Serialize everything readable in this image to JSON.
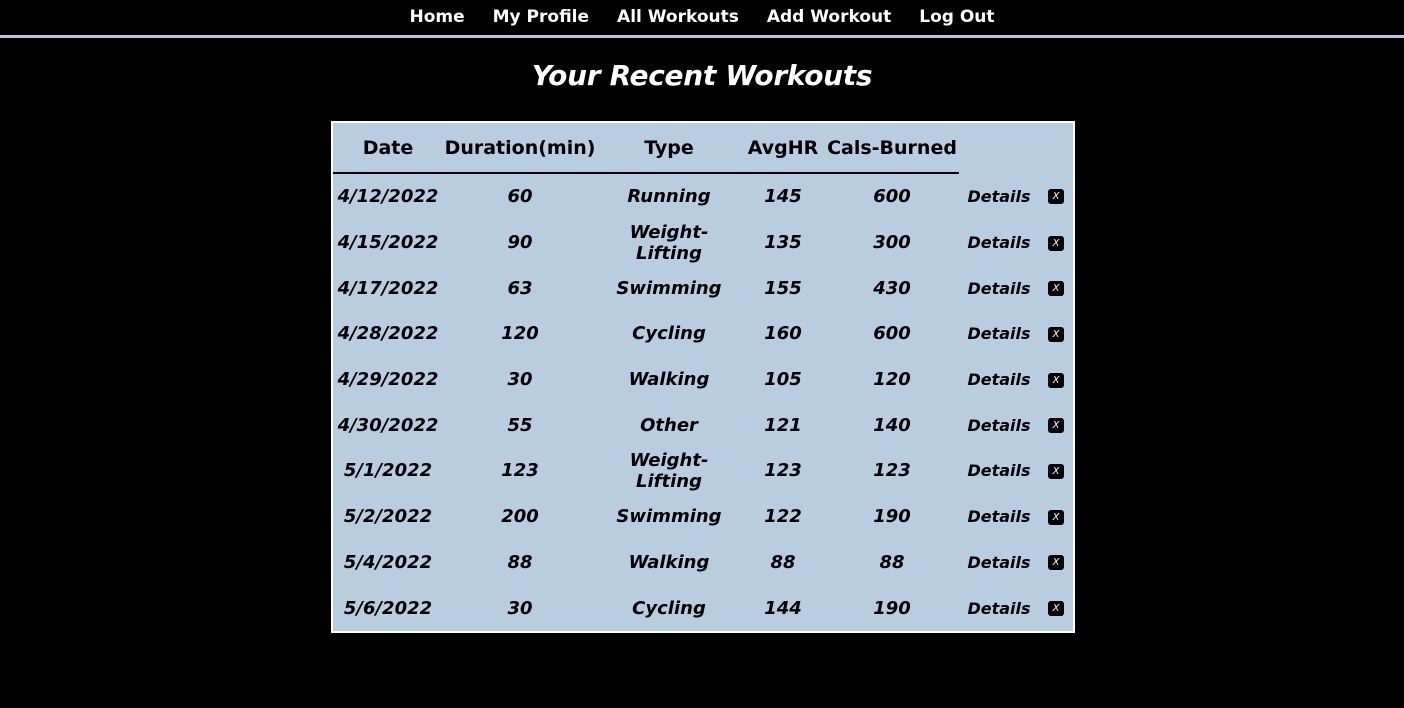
{
  "nav": {
    "items": [
      "Home",
      "My Profile",
      "All Workouts",
      "Add Workout",
      "Log Out"
    ]
  },
  "page": {
    "title": "Your Recent Workouts"
  },
  "table": {
    "headers": [
      "Date",
      "Duration(min)",
      "Type",
      "AvgHR",
      "Cals-Burned"
    ],
    "details_label": "Details",
    "delete_label": "X",
    "rows": [
      {
        "date": "4/12/2022",
        "duration": "60",
        "type": "Running",
        "avghr": "145",
        "cals": "600"
      },
      {
        "date": "4/15/2022",
        "duration": "90",
        "type": "Weight-Lifting",
        "avghr": "135",
        "cals": "300"
      },
      {
        "date": "4/17/2022",
        "duration": "63",
        "type": "Swimming",
        "avghr": "155",
        "cals": "430"
      },
      {
        "date": "4/28/2022",
        "duration": "120",
        "type": "Cycling",
        "avghr": "160",
        "cals": "600"
      },
      {
        "date": "4/29/2022",
        "duration": "30",
        "type": "Walking",
        "avghr": "105",
        "cals": "120"
      },
      {
        "date": "4/30/2022",
        "duration": "55",
        "type": "Other",
        "avghr": "121",
        "cals": "140"
      },
      {
        "date": "5/1/2022",
        "duration": "123",
        "type": "Weight-Lifting",
        "avghr": "123",
        "cals": "123"
      },
      {
        "date": "5/2/2022",
        "duration": "200",
        "type": "Swimming",
        "avghr": "122",
        "cals": "190"
      },
      {
        "date": "5/4/2022",
        "duration": "88",
        "type": "Walking",
        "avghr": "88",
        "cals": "88"
      },
      {
        "date": "5/6/2022",
        "duration": "30",
        "type": "Cycling",
        "avghr": "144",
        "cals": "190"
      }
    ]
  },
  "colors": {
    "background": "#000000",
    "table_bg": "#b8cee0",
    "nav_border": "#b8c6dd",
    "text_light": "#ffffff"
  }
}
